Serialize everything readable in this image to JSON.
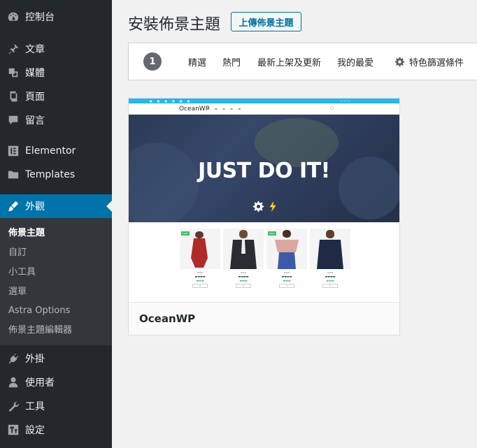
{
  "sidebar": {
    "items": [
      {
        "label": "控制台",
        "icon": "dashboard-icon"
      },
      {
        "label": "文章",
        "icon": "pin-icon"
      },
      {
        "label": "媒體",
        "icon": "media-icon"
      },
      {
        "label": "頁面",
        "icon": "pages-icon"
      },
      {
        "label": "留言",
        "icon": "comments-icon"
      },
      {
        "label": "Elementor",
        "icon": "elementor-icon"
      },
      {
        "label": "Templates",
        "icon": "folder-icon"
      },
      {
        "label": "外觀",
        "icon": "brush-icon"
      },
      {
        "label": "外掛",
        "icon": "plugin-icon"
      },
      {
        "label": "使用者",
        "icon": "user-icon"
      },
      {
        "label": "工具",
        "icon": "wrench-icon"
      },
      {
        "label": "設定",
        "icon": "settings-icon"
      }
    ],
    "submenu": [
      "佈景主題",
      "自訂",
      "小工具",
      "選單",
      "Astra Options",
      "佈景主題編輯器"
    ]
  },
  "header": {
    "title": "安裝佈景主題",
    "upload_label": "上傳佈景主題"
  },
  "filter": {
    "count": "1",
    "links": [
      "精選",
      "熱門",
      "最新上架及更新",
      "我的最愛"
    ],
    "features_label": "特色篩選條件"
  },
  "theme": {
    "name": "OceanWP",
    "preview": {
      "logo": "OceanWP",
      "hero_text": "JUST DO IT!",
      "accent": "#2ab6e9",
      "sale_color": "#3ec06a"
    }
  }
}
